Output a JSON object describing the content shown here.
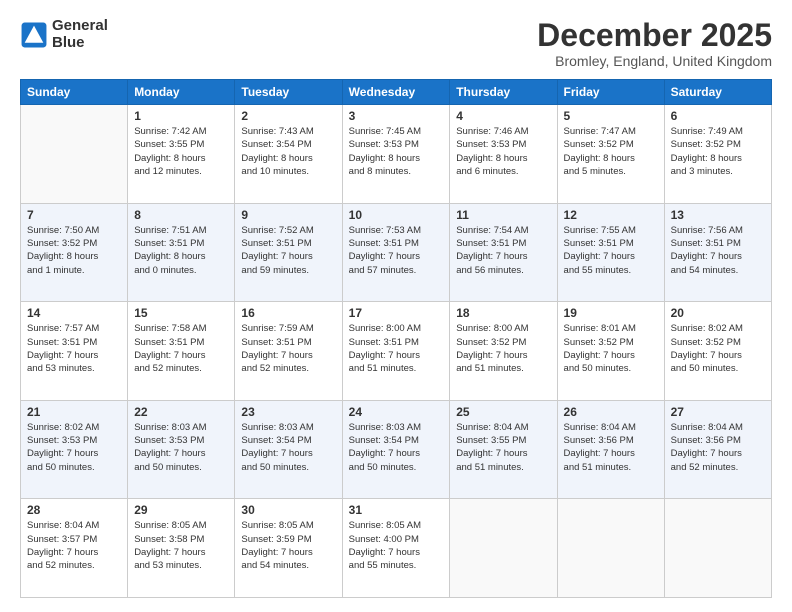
{
  "logo": {
    "line1": "General",
    "line2": "Blue"
  },
  "title": "December 2025",
  "location": "Bromley, England, United Kingdom",
  "headers": [
    "Sunday",
    "Monday",
    "Tuesday",
    "Wednesday",
    "Thursday",
    "Friday",
    "Saturday"
  ],
  "weeks": [
    [
      {
        "day": "",
        "info": ""
      },
      {
        "day": "1",
        "info": "Sunrise: 7:42 AM\nSunset: 3:55 PM\nDaylight: 8 hours\nand 12 minutes."
      },
      {
        "day": "2",
        "info": "Sunrise: 7:43 AM\nSunset: 3:54 PM\nDaylight: 8 hours\nand 10 minutes."
      },
      {
        "day": "3",
        "info": "Sunrise: 7:45 AM\nSunset: 3:53 PM\nDaylight: 8 hours\nand 8 minutes."
      },
      {
        "day": "4",
        "info": "Sunrise: 7:46 AM\nSunset: 3:53 PM\nDaylight: 8 hours\nand 6 minutes."
      },
      {
        "day": "5",
        "info": "Sunrise: 7:47 AM\nSunset: 3:52 PM\nDaylight: 8 hours\nand 5 minutes."
      },
      {
        "day": "6",
        "info": "Sunrise: 7:49 AM\nSunset: 3:52 PM\nDaylight: 8 hours\nand 3 minutes."
      }
    ],
    [
      {
        "day": "7",
        "info": "Sunrise: 7:50 AM\nSunset: 3:52 PM\nDaylight: 8 hours\nand 1 minute."
      },
      {
        "day": "8",
        "info": "Sunrise: 7:51 AM\nSunset: 3:51 PM\nDaylight: 8 hours\nand 0 minutes."
      },
      {
        "day": "9",
        "info": "Sunrise: 7:52 AM\nSunset: 3:51 PM\nDaylight: 7 hours\nand 59 minutes."
      },
      {
        "day": "10",
        "info": "Sunrise: 7:53 AM\nSunset: 3:51 PM\nDaylight: 7 hours\nand 57 minutes."
      },
      {
        "day": "11",
        "info": "Sunrise: 7:54 AM\nSunset: 3:51 PM\nDaylight: 7 hours\nand 56 minutes."
      },
      {
        "day": "12",
        "info": "Sunrise: 7:55 AM\nSunset: 3:51 PM\nDaylight: 7 hours\nand 55 minutes."
      },
      {
        "day": "13",
        "info": "Sunrise: 7:56 AM\nSunset: 3:51 PM\nDaylight: 7 hours\nand 54 minutes."
      }
    ],
    [
      {
        "day": "14",
        "info": "Sunrise: 7:57 AM\nSunset: 3:51 PM\nDaylight: 7 hours\nand 53 minutes."
      },
      {
        "day": "15",
        "info": "Sunrise: 7:58 AM\nSunset: 3:51 PM\nDaylight: 7 hours\nand 52 minutes."
      },
      {
        "day": "16",
        "info": "Sunrise: 7:59 AM\nSunset: 3:51 PM\nDaylight: 7 hours\nand 52 minutes."
      },
      {
        "day": "17",
        "info": "Sunrise: 8:00 AM\nSunset: 3:51 PM\nDaylight: 7 hours\nand 51 minutes."
      },
      {
        "day": "18",
        "info": "Sunrise: 8:00 AM\nSunset: 3:52 PM\nDaylight: 7 hours\nand 51 minutes."
      },
      {
        "day": "19",
        "info": "Sunrise: 8:01 AM\nSunset: 3:52 PM\nDaylight: 7 hours\nand 50 minutes."
      },
      {
        "day": "20",
        "info": "Sunrise: 8:02 AM\nSunset: 3:52 PM\nDaylight: 7 hours\nand 50 minutes."
      }
    ],
    [
      {
        "day": "21",
        "info": "Sunrise: 8:02 AM\nSunset: 3:53 PM\nDaylight: 7 hours\nand 50 minutes."
      },
      {
        "day": "22",
        "info": "Sunrise: 8:03 AM\nSunset: 3:53 PM\nDaylight: 7 hours\nand 50 minutes."
      },
      {
        "day": "23",
        "info": "Sunrise: 8:03 AM\nSunset: 3:54 PM\nDaylight: 7 hours\nand 50 minutes."
      },
      {
        "day": "24",
        "info": "Sunrise: 8:03 AM\nSunset: 3:54 PM\nDaylight: 7 hours\nand 50 minutes."
      },
      {
        "day": "25",
        "info": "Sunrise: 8:04 AM\nSunset: 3:55 PM\nDaylight: 7 hours\nand 51 minutes."
      },
      {
        "day": "26",
        "info": "Sunrise: 8:04 AM\nSunset: 3:56 PM\nDaylight: 7 hours\nand 51 minutes."
      },
      {
        "day": "27",
        "info": "Sunrise: 8:04 AM\nSunset: 3:56 PM\nDaylight: 7 hours\nand 52 minutes."
      }
    ],
    [
      {
        "day": "28",
        "info": "Sunrise: 8:04 AM\nSunset: 3:57 PM\nDaylight: 7 hours\nand 52 minutes."
      },
      {
        "day": "29",
        "info": "Sunrise: 8:05 AM\nSunset: 3:58 PM\nDaylight: 7 hours\nand 53 minutes."
      },
      {
        "day": "30",
        "info": "Sunrise: 8:05 AM\nSunset: 3:59 PM\nDaylight: 7 hours\nand 54 minutes."
      },
      {
        "day": "31",
        "info": "Sunrise: 8:05 AM\nSunset: 4:00 PM\nDaylight: 7 hours\nand 55 minutes."
      },
      {
        "day": "",
        "info": ""
      },
      {
        "day": "",
        "info": ""
      },
      {
        "day": "",
        "info": ""
      }
    ]
  ]
}
